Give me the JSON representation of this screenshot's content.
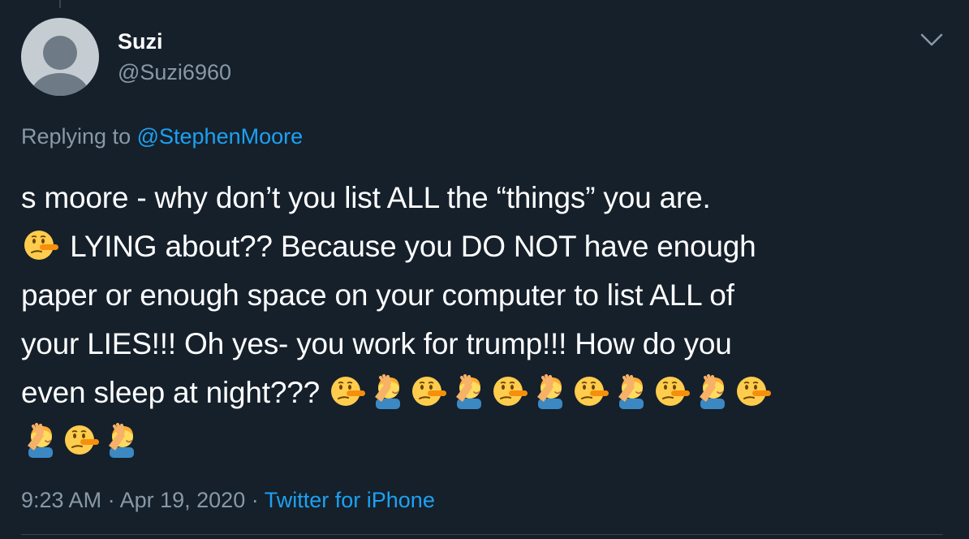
{
  "tweet": {
    "author": {
      "display_name": "Suzi",
      "handle": "@Suzi6960"
    },
    "replying_prefix": "Replying to",
    "replying_to": "@StephenMoore",
    "text": {
      "line1": "s moore - why don’t you list ALL the “things” you are.",
      "line2": "LYING about??  Because you DO NOT have enough",
      "line3": "paper or enough space on your computer to list ALL of",
      "line4": "your LIES!!!  Oh yes- you work for trump!!!  How do you",
      "line5": "even sleep at night???"
    },
    "emoji_names": [
      "lying-face",
      "person-facepalming"
    ],
    "time": "9:23 AM",
    "separator": "·",
    "date": "Apr 19, 2020",
    "source": "Twitter for iPhone"
  },
  "colors": {
    "background": "#15202b",
    "text": "#ffffff",
    "secondary": "#8899a6",
    "link": "#1da1f2",
    "divider": "#38444d"
  }
}
